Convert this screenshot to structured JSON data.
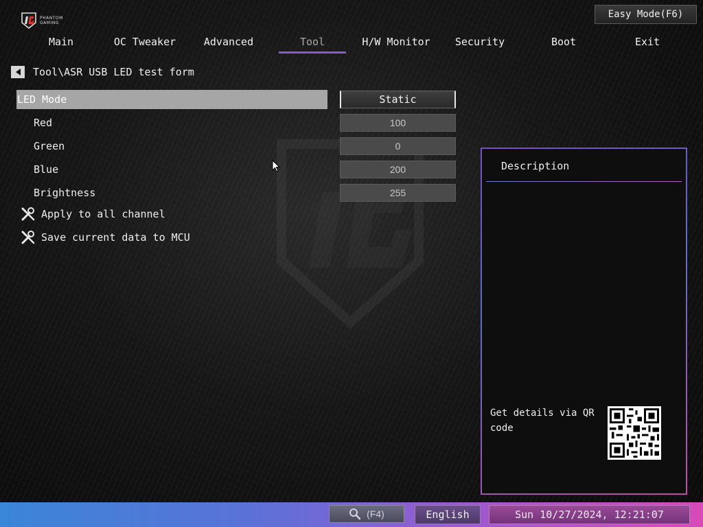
{
  "brand": {
    "logo_text_line1": "PHANTOM",
    "logo_text_line2": "GAMING",
    "logo_icon": "phantom-gaming-logo-icon"
  },
  "header": {
    "easy_mode_label": "Easy Mode(F6)"
  },
  "tabs": [
    {
      "label": "Main"
    },
    {
      "label": "OC Tweaker"
    },
    {
      "label": "Advanced"
    },
    {
      "label": "Tool",
      "active": true
    },
    {
      "label": "H/W Monitor"
    },
    {
      "label": "Security"
    },
    {
      "label": "Boot"
    },
    {
      "label": "Exit"
    }
  ],
  "breadcrumb": {
    "back_icon": "back-arrow-icon",
    "path": "Tool\\ASR USB LED test form"
  },
  "settings": {
    "led_mode": {
      "label": "LED Mode",
      "value": "Static"
    },
    "red": {
      "label": "Red",
      "value": "100"
    },
    "green": {
      "label": "Green",
      "value": "0"
    },
    "blue": {
      "label": "Blue",
      "value": "200"
    },
    "brightness": {
      "label": "Brightness",
      "value": "255"
    }
  },
  "actions": [
    {
      "label": "Apply to all channel",
      "icon": "tools-icon"
    },
    {
      "label": "Save current data to MCU",
      "icon": "tools-icon"
    }
  ],
  "description": {
    "title": "Description",
    "qr_text": "Get details via QR code",
    "qr_icon": "qr-code-icon"
  },
  "footer": {
    "search_label": "(F4)",
    "search_icon": "search-icon",
    "language": "English",
    "datetime": "Sun 10/27/2024, 12:21:07"
  },
  "colors": {
    "accent_purple": "#8a5ad0",
    "selected_row": "#a6a6a6",
    "footer_start": "#3a86d8",
    "footer_end": "#d84ab8"
  }
}
